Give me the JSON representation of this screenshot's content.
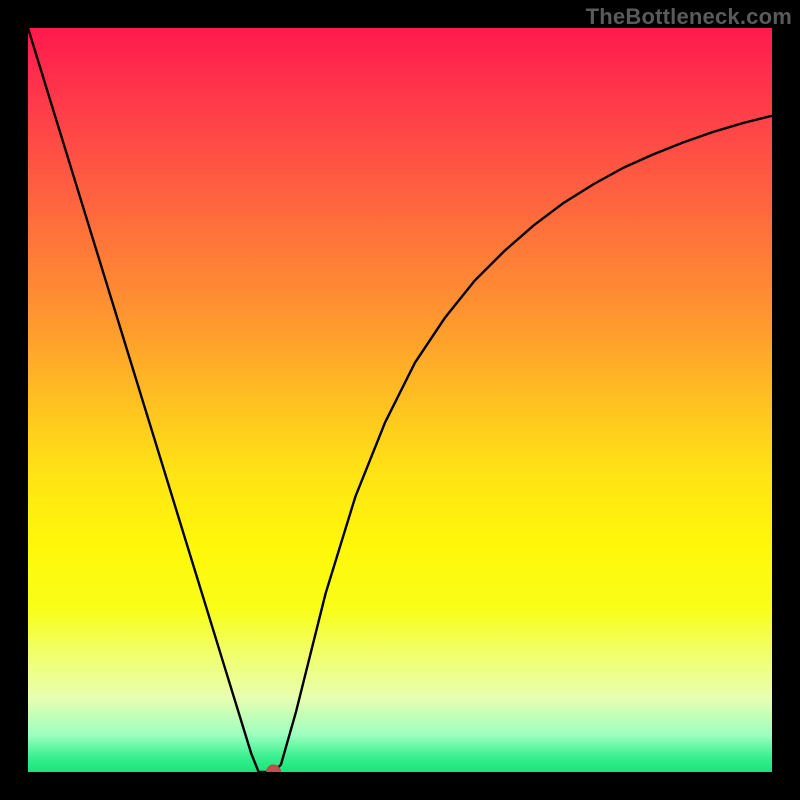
{
  "watermark": "TheBottleneck.com",
  "chart_data": {
    "type": "line",
    "title": "",
    "xlabel": "",
    "ylabel": "",
    "xlim": [
      0,
      100
    ],
    "ylim": [
      0,
      100
    ],
    "x": [
      0,
      2,
      4,
      6,
      8,
      10,
      12,
      14,
      16,
      18,
      20,
      22,
      24,
      26,
      28,
      30,
      31,
      32,
      33,
      34,
      36,
      38,
      40,
      44,
      48,
      52,
      56,
      60,
      64,
      68,
      72,
      76,
      80,
      84,
      88,
      92,
      96,
      100
    ],
    "y": [
      100,
      93.5,
      87,
      80.5,
      74,
      67.5,
      61,
      54.5,
      48,
      41.5,
      35,
      28.5,
      22,
      15.5,
      9,
      2.5,
      0,
      0,
      0,
      1,
      8,
      16,
      24,
      37,
      47,
      55,
      61,
      66,
      70,
      73.5,
      76.5,
      79,
      81.2,
      83,
      84.6,
      86,
      87.2,
      88.2
    ],
    "minimum_marker": {
      "x": 33,
      "y": 0,
      "color": "#c0504d"
    },
    "gradient_stops": [
      {
        "pos": 0,
        "color": "#ff1a4d"
      },
      {
        "pos": 50,
        "color": "#ffc022"
      },
      {
        "pos": 78,
        "color": "#f2ff6a"
      },
      {
        "pos": 100,
        "color": "#18e47a"
      }
    ]
  }
}
